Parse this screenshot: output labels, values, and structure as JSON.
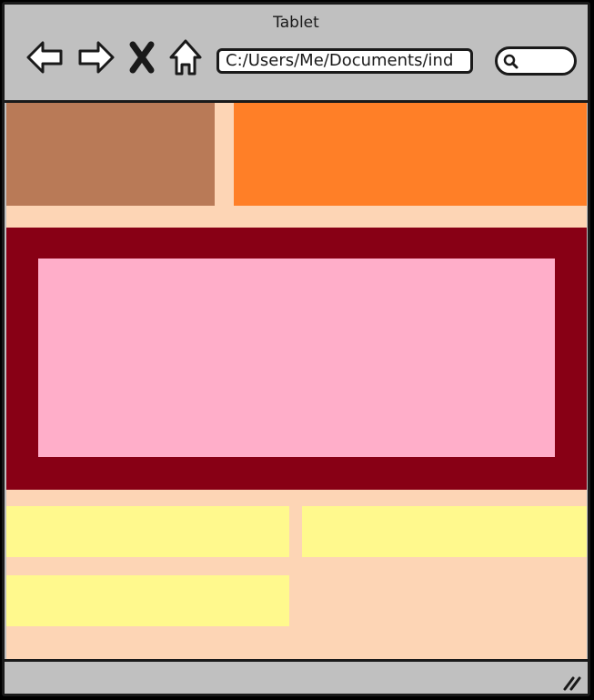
{
  "window": {
    "title": "Tablet"
  },
  "toolbar": {
    "back_icon": "back-arrow-icon",
    "forward_icon": "forward-arrow-icon",
    "stop_icon": "stop-x-icon",
    "home_icon": "home-icon",
    "address_value": "C:/Users/Me/Documents/ind",
    "search_icon": "search-icon"
  },
  "layout_colors": {
    "background": "#fdd5b5",
    "header_left": "#b97a57",
    "header_right": "#ff7f27",
    "hero_outer": "#880015",
    "hero_inner": "#ffaec9",
    "tiles": "#fff98d"
  }
}
